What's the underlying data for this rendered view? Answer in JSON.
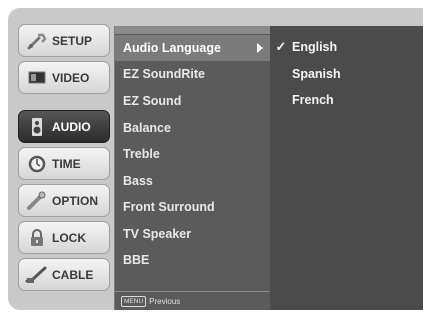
{
  "sidebar": {
    "items": [
      {
        "label": "SETUP",
        "icon": "wrench-icon",
        "active": false
      },
      {
        "label": "VIDEO",
        "icon": "monitor-icon",
        "active": false
      },
      {
        "label": "AUDIO",
        "icon": "speaker-icon",
        "active": true
      },
      {
        "label": "TIME",
        "icon": "clock-icon",
        "active": false
      },
      {
        "label": "OPTION",
        "icon": "option-icon",
        "active": false
      },
      {
        "label": "LOCK",
        "icon": "lock-icon",
        "active": false
      },
      {
        "label": "CABLE",
        "icon": "cable-icon",
        "active": false
      }
    ]
  },
  "submenu": {
    "items": [
      {
        "label": "Audio Language",
        "selected": true,
        "has_arrow": true
      },
      {
        "label": "EZ SoundRite"
      },
      {
        "label": "EZ Sound"
      },
      {
        "label": "Balance"
      },
      {
        "label": "Treble"
      },
      {
        "label": "Bass"
      },
      {
        "label": "Front Surround"
      },
      {
        "label": "TV Speaker"
      },
      {
        "label": "BBE"
      }
    ],
    "footer": {
      "key_label": "MENU",
      "text": "Previous"
    }
  },
  "options": {
    "items": [
      {
        "label": "English",
        "checked": true
      },
      {
        "label": "Spanish",
        "checked": false
      },
      {
        "label": "French",
        "checked": false
      }
    ],
    "check_glyph": "✓"
  }
}
